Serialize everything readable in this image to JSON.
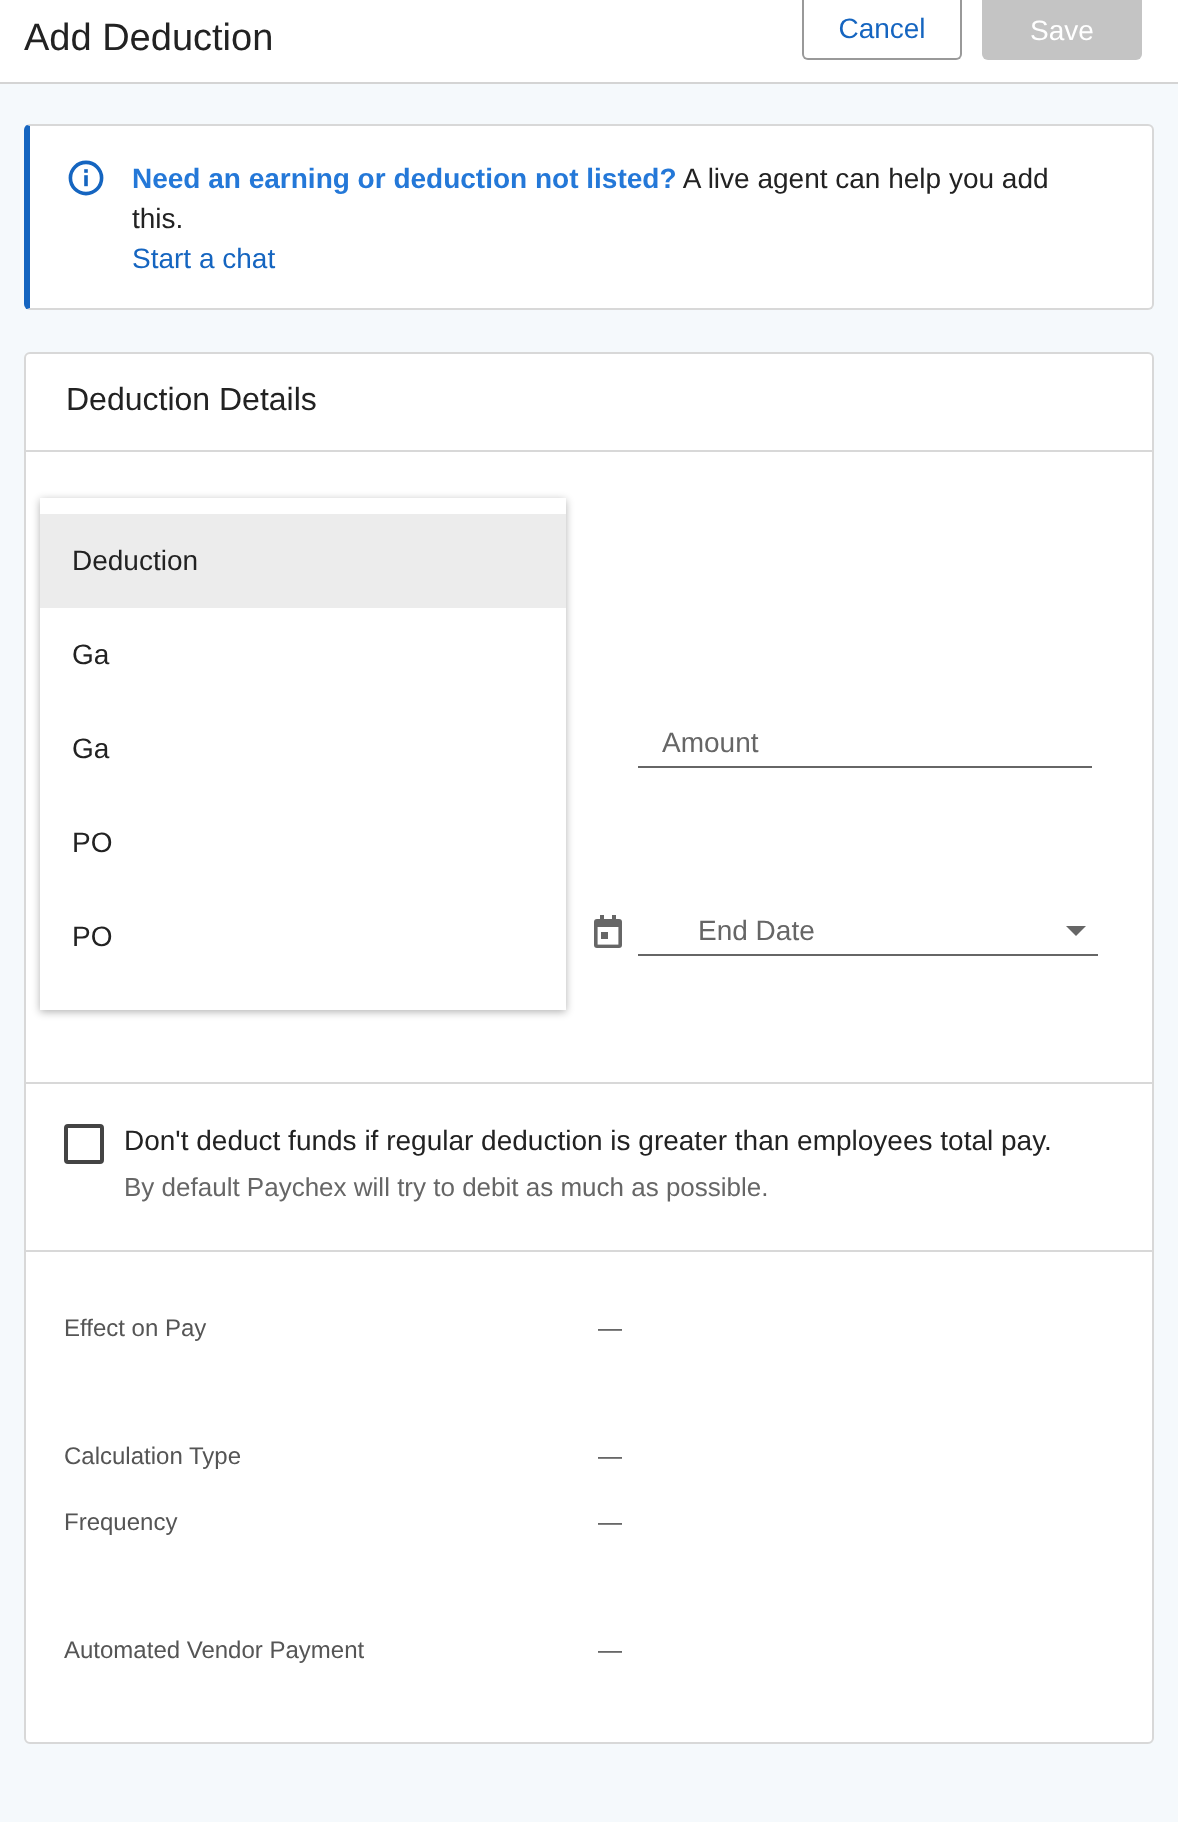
{
  "header": {
    "title": "Add Deduction",
    "buttons": [
      {
        "label": "Cancel",
        "kind": "secondary",
        "disabled": false
      },
      {
        "label": "Save",
        "kind": "primary",
        "disabled": true
      }
    ]
  },
  "notice": {
    "text": "**Need an earning or deduction not listed?** A live agent can help you add this.",
    "link": "Start a chat"
  },
  "card": {
    "title": "Deduction Details",
    "menu": [
      {
        "label": "Deduction",
        "selected": true
      },
      {
        "label": "Ga",
        "selected": false
      },
      {
        "label": "Ga",
        "selected": false
      },
      {
        "label": "PO",
        "selected": false
      },
      {
        "label": "PO",
        "selected": false
      }
    ],
    "amount": {
      "placeholder": "Amount"
    },
    "end_date": {
      "placeholder": "End Date"
    },
    "option": {
      "label": "Don't deduct funds if regular deduction is greater than employees total pay.",
      "hint": "By default Paychex will try to debit as much as possible.",
      "checked": false
    },
    "summary": [
      [
        {
          "label": "Effect on Pay",
          "value": "—"
        }
      ],
      [
        {
          "label": "Calculation Type",
          "value": "—"
        },
        {
          "label": "Frequency",
          "value": "—"
        }
      ],
      [
        {
          "label": "Automated Vendor Payment",
          "value": "—"
        }
      ]
    ]
  }
}
